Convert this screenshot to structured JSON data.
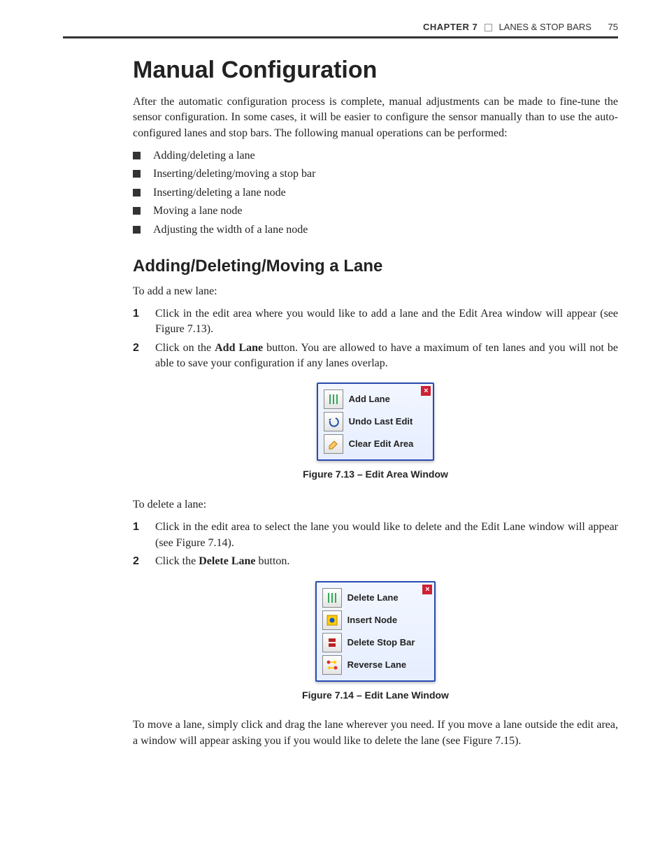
{
  "header": {
    "chapter_label": "CHAPTER 7",
    "chapter_title": "LANES & STOP BARS",
    "page_number": "75"
  },
  "title": "Manual Configuration",
  "intro": "After the automatic configuration process is complete, manual adjustments can be made to fine-tune the sensor configuration. In some cases, it will be easier to configure the sensor manually than to use the auto-configured lanes and stop bars. The following manual operations can be performed:",
  "bullets": [
    "Adding/deleting a lane",
    "Inserting/deleting/moving a stop bar",
    "Inserting/deleting a lane node",
    "Moving a lane node",
    "Adjusting the width of a lane node"
  ],
  "section1": {
    "title": "Adding/Deleting/Moving a Lane",
    "add_intro": "To add a new lane:",
    "add_steps": [
      {
        "num": "1",
        "text_pre": "Click in the edit area where you would like to add a lane and the Edit Area window will appear (see Figure 7.13)."
      },
      {
        "num": "2",
        "text_pre": "Click on the ",
        "bold": "Add Lane",
        "text_post": " button. You are allowed to have a maximum of ten lanes and you will not be able to save your configuration if any lanes overlap."
      }
    ],
    "figure1": {
      "caption": "Figure 7.13 – Edit Area Window",
      "items": [
        {
          "icon": "lane-bars",
          "label": "Add Lane"
        },
        {
          "icon": "undo",
          "label": "Undo Last Edit"
        },
        {
          "icon": "eraser",
          "label": "Clear Edit Area"
        }
      ]
    },
    "delete_intro": "To delete a lane:",
    "delete_steps": [
      {
        "num": "1",
        "text_pre": "Click in the edit area to select the lane you would like to delete and the Edit Lane window will appear (see Figure 7.14)."
      },
      {
        "num": "2",
        "text_pre": "Click the ",
        "bold": "Delete Lane",
        "text_post": " button."
      }
    ],
    "figure2": {
      "caption": "Figure 7.14 – Edit Lane Window",
      "items": [
        {
          "icon": "lane-bars",
          "label": "Delete Lane"
        },
        {
          "icon": "node",
          "label": "Insert Node"
        },
        {
          "icon": "stopbar",
          "label": "Delete Stop Bar"
        },
        {
          "icon": "reverse",
          "label": "Reverse Lane"
        }
      ]
    },
    "move_text": "To move a lane, simply click and drag the lane wherever you need. If you move a lane outside the edit area, a window will appear asking you if you would like to delete the lane (see Figure 7.15)."
  }
}
